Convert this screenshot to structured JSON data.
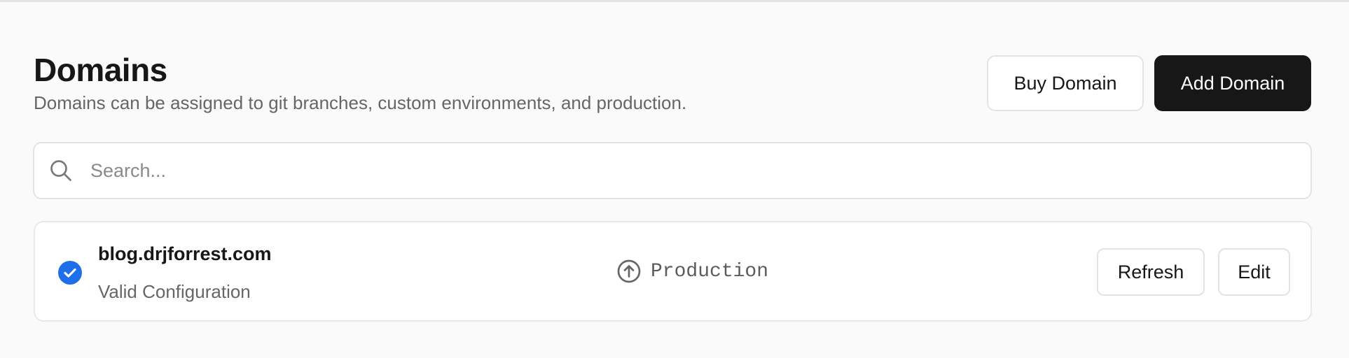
{
  "header": {
    "title": "Domains",
    "subtitle": "Domains can be assigned to git branches, custom environments, and production."
  },
  "actions": {
    "buy_label": "Buy Domain",
    "add_label": "Add Domain"
  },
  "search": {
    "placeholder": "Search...",
    "value": "",
    "icon": "search-icon"
  },
  "domains": [
    {
      "name": "blog.drjforrest.com",
      "status": "Valid Configuration",
      "status_icon": "check-circle-icon",
      "status_color": "#1f6feb",
      "environment": "Production",
      "environment_icon": "arrow-up-circle-icon",
      "refresh_label": "Refresh",
      "edit_label": "Edit"
    }
  ],
  "colors": {
    "primary_button": "#171717",
    "background": "#fafafa",
    "valid": "#1f6feb"
  }
}
